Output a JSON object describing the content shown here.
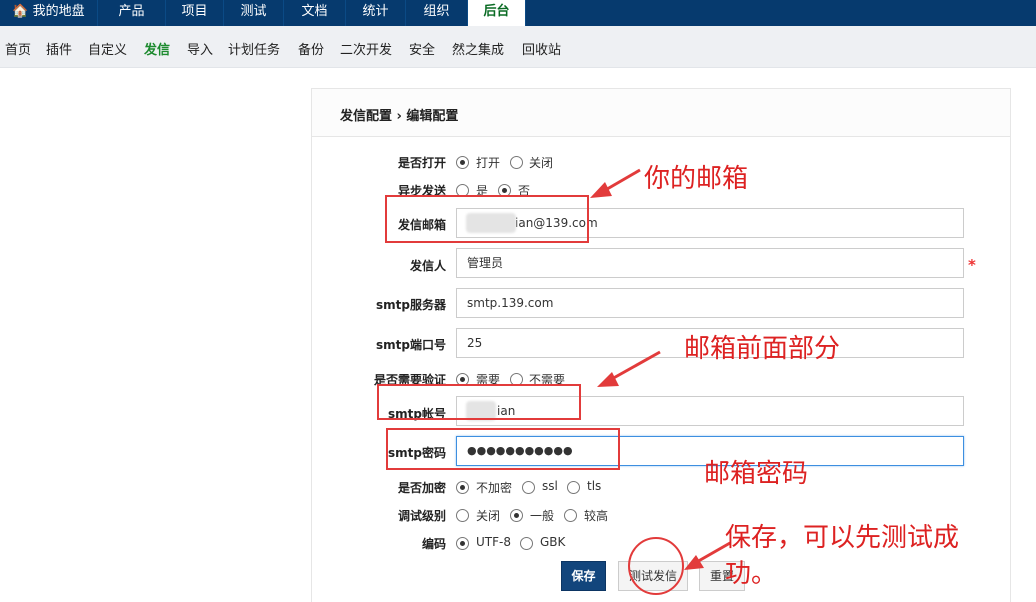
{
  "topnav": {
    "tabs": [
      {
        "label": "🏠 我的地盘",
        "active": false
      },
      {
        "label": "产品",
        "active": false
      },
      {
        "label": "项目",
        "active": false
      },
      {
        "label": "测试",
        "active": false
      },
      {
        "label": "文档",
        "active": false
      },
      {
        "label": "统计",
        "active": false
      },
      {
        "label": "组织",
        "active": false
      },
      {
        "label": "后台",
        "active": true
      }
    ]
  },
  "subnav": {
    "items": [
      "首页",
      "插件",
      "自定义",
      "发信",
      "导入",
      "计划任务",
      "备份",
      "二次开发",
      "安全",
      "然之集成",
      "回收站"
    ],
    "active": "发信"
  },
  "panel": {
    "breadcrumb": "发信配置 › 编辑配置"
  },
  "form": {
    "turnon": {
      "label": "是否打开",
      "options": [
        "打开",
        "关闭"
      ],
      "selected": "打开"
    },
    "async": {
      "label": "异步发送",
      "options": [
        "是",
        "否"
      ],
      "selected": "否"
    },
    "from_address": {
      "label": "发信邮箱",
      "value": "ian@139.com"
    },
    "from_name": {
      "label": "发信人",
      "value": "管理员",
      "required_mark": "*"
    },
    "smtp_host": {
      "label": "smtp服务器",
      "value": "smtp.139.com"
    },
    "smtp_port": {
      "label": "smtp端口号",
      "value": "25"
    },
    "smtp_auth": {
      "label": "是否需要验证",
      "options": [
        "需要",
        "不需要"
      ],
      "selected": "需要"
    },
    "smtp_username": {
      "label": "smtp帐号",
      "value": "ian"
    },
    "smtp_password": {
      "label": "smtp密码",
      "value": "●●●●●●●●●●●"
    },
    "secure": {
      "label": "是否加密",
      "options": [
        "不加密",
        "ssl",
        "tls"
      ],
      "selected": "不加密"
    },
    "debug": {
      "label": "调试级别",
      "options": [
        "关闭",
        "一般",
        "较高"
      ],
      "selected": "一般"
    },
    "charset": {
      "label": "编码",
      "options": [
        "UTF-8",
        "GBK"
      ],
      "selected": "UTF-8"
    }
  },
  "buttons": {
    "save": "保存",
    "test": "测试发信",
    "reset": "重置"
  },
  "annotations": {
    "mailbox": "你的邮箱",
    "username": "邮箱前面部分",
    "password": "邮箱密码",
    "save_tip_line1": "保存，可以先测试成",
    "save_tip_line2": "功。"
  },
  "colors": {
    "nav_bg": "#063a6e",
    "annotation_red": "#e23b3b",
    "primary_button": "#12457c",
    "active_subnav": "#1c8a2e"
  }
}
